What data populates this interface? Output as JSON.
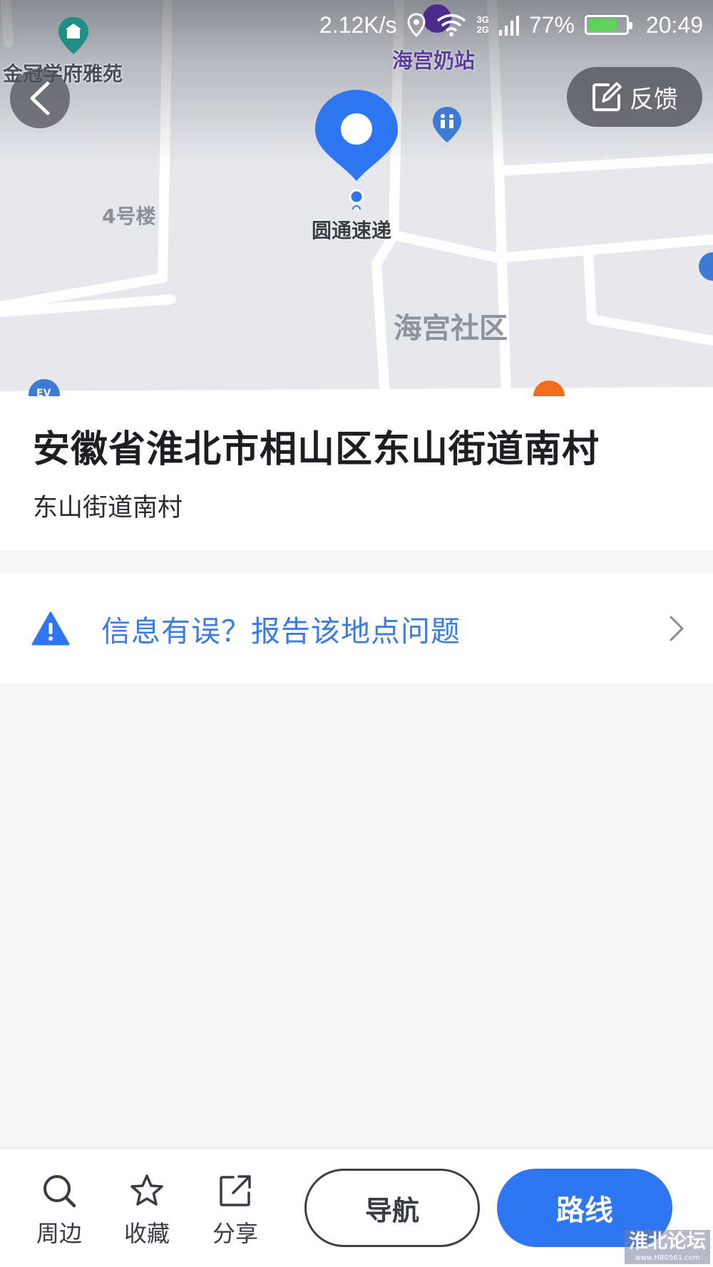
{
  "status_bar": {
    "network_speed": "2.12K/s",
    "signal_labels": [
      "3G",
      "2G"
    ],
    "battery": "77%",
    "battery_level": 0.77,
    "time": "20:49",
    "icons": [
      "location-icon",
      "wifi-icon",
      "signal-icon",
      "battery-icon"
    ]
  },
  "map": {
    "labels": {
      "poi_school": "金冠学府雅苑",
      "poi_milk": "海宫奶站",
      "building": "4号楼",
      "poi_courier": "圆通速递",
      "community": "海宫社区"
    },
    "feedback_label": "反馈"
  },
  "place": {
    "title": "安徽省淮北市相山区东山街道南村",
    "subtitle": "东山街道南村"
  },
  "report": {
    "label": "信息有误？报告该地点问题"
  },
  "bottom_bar": {
    "nearby_label": "周边",
    "favorite_label": "收藏",
    "share_label": "分享",
    "navigate_label": "导航",
    "route_label": "路线"
  },
  "watermark": {
    "title": "淮北论坛",
    "url": "www.HB0561.com"
  },
  "colors": {
    "accent": "#2f76f5",
    "link": "#3a7bea",
    "battery_fill": "#5ed15a",
    "map_bg": "#e6e8ee"
  }
}
